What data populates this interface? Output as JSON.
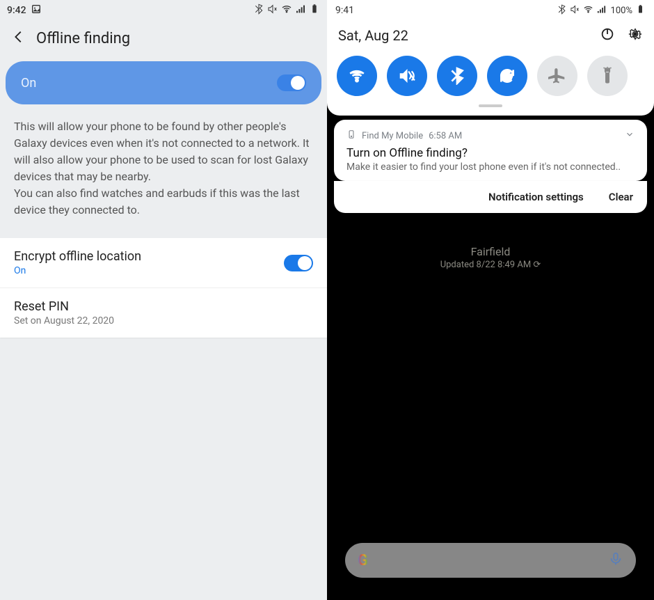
{
  "left": {
    "status_time": "9:42",
    "header_title": "Offline finding",
    "pill_label": "On",
    "description": "This will allow your phone to be found by other people's Galaxy devices even when it's not connected to a network. It will also allow your phone to be used to scan for lost Galaxy devices that may be nearby.\nYou can also find watches and earbuds if this was the last device they connected to.",
    "encrypt": {
      "title": "Encrypt offline location",
      "sub": "On"
    },
    "reset_pin": {
      "title": "Reset PIN",
      "sub": "Set on August 22, 2020"
    }
  },
  "right": {
    "status_time": "9:41",
    "battery_pct": "100%",
    "date": "Sat, Aug 22",
    "qs": [
      {
        "name": "wifi",
        "on": true
      },
      {
        "name": "sound-mute",
        "on": true
      },
      {
        "name": "bluetooth",
        "on": true
      },
      {
        "name": "sync",
        "on": true
      },
      {
        "name": "airplane",
        "on": false
      },
      {
        "name": "flashlight",
        "on": false
      }
    ],
    "notif": {
      "app": "Find My Mobile",
      "time": "6:58 AM",
      "title": "Turn on Offline finding?",
      "body": "Make it easier to find your lost phone even if it's not connected.."
    },
    "actions": {
      "settings": "Notification settings",
      "clear": "Clear"
    },
    "weather": {
      "location": "Fairfield",
      "updated": "Updated 8/22 8:49 AM ⟳"
    },
    "search": {
      "logo": "G"
    }
  }
}
